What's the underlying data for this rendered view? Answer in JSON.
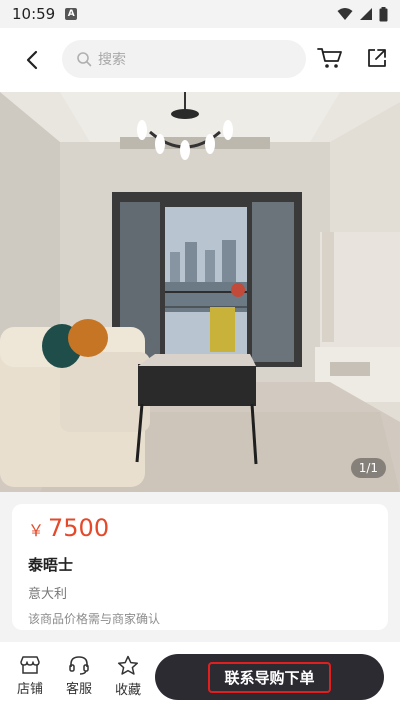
{
  "status_bar": {
    "time": "10:59",
    "notification_icon": "A"
  },
  "header": {
    "search_placeholder": "搜索"
  },
  "gallery": {
    "page_indicator": "1/1"
  },
  "product": {
    "currency": "￥",
    "price": "7500",
    "name": "泰晤士",
    "origin": "意大利",
    "note": "该商品价格需与商家确认"
  },
  "bottom_bar": {
    "store_label": "店铺",
    "service_label": "客服",
    "favorite_label": "收藏",
    "cta_label": "联系导购下单"
  },
  "colors": {
    "accent": "#e4492a",
    "cta_bg": "#2c2b32",
    "highlight_border": "#e02020"
  }
}
